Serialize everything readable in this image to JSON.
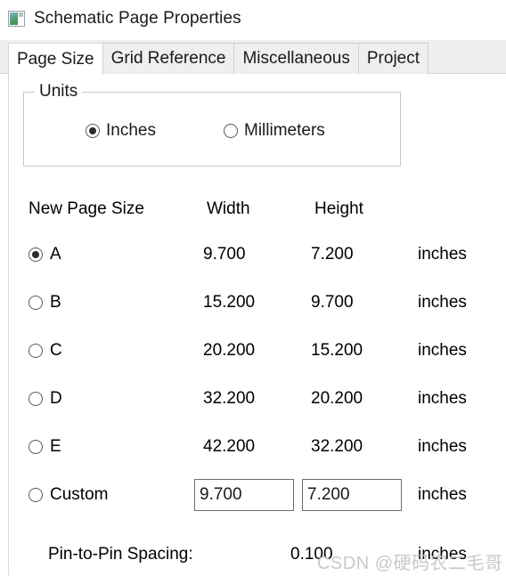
{
  "window": {
    "title": "Schematic Page Properties",
    "icon": "schematic-page-icon"
  },
  "tabs": [
    {
      "label": "Page Size",
      "selected": true
    },
    {
      "label": "Grid Reference",
      "selected": false
    },
    {
      "label": "Miscellaneous",
      "selected": false
    },
    {
      "label": "Project",
      "selected": false
    }
  ],
  "units_group": {
    "legend": "Units",
    "options": [
      {
        "label": "Inches",
        "checked": true
      },
      {
        "label": "Millimeters",
        "checked": false
      }
    ]
  },
  "page_size": {
    "headers": {
      "name": "New Page Size",
      "width": "Width",
      "height": "Height",
      "units": ""
    },
    "rows": [
      {
        "label": "A",
        "width": "9.700",
        "height": "7.200",
        "units": "inches",
        "checked": true
      },
      {
        "label": "B",
        "width": "15.200",
        "height": "9.700",
        "units": "inches",
        "checked": false
      },
      {
        "label": "C",
        "width": "20.200",
        "height": "15.200",
        "units": "inches",
        "checked": false
      },
      {
        "label": "D",
        "width": "32.200",
        "height": "20.200",
        "units": "inches",
        "checked": false
      },
      {
        "label": "E",
        "width": "42.200",
        "height": "32.200",
        "units": "inches",
        "checked": false
      }
    ],
    "custom": {
      "label": "Custom",
      "checked": false,
      "width_value": "9.700",
      "height_value": "7.200",
      "units": "inches"
    }
  },
  "pin_spacing": {
    "label": "Pin-to-Pin Spacing:",
    "value": "0.100",
    "units": "inches"
  },
  "watermark": {
    "text": "CSDN @硬码农二毛哥"
  }
}
